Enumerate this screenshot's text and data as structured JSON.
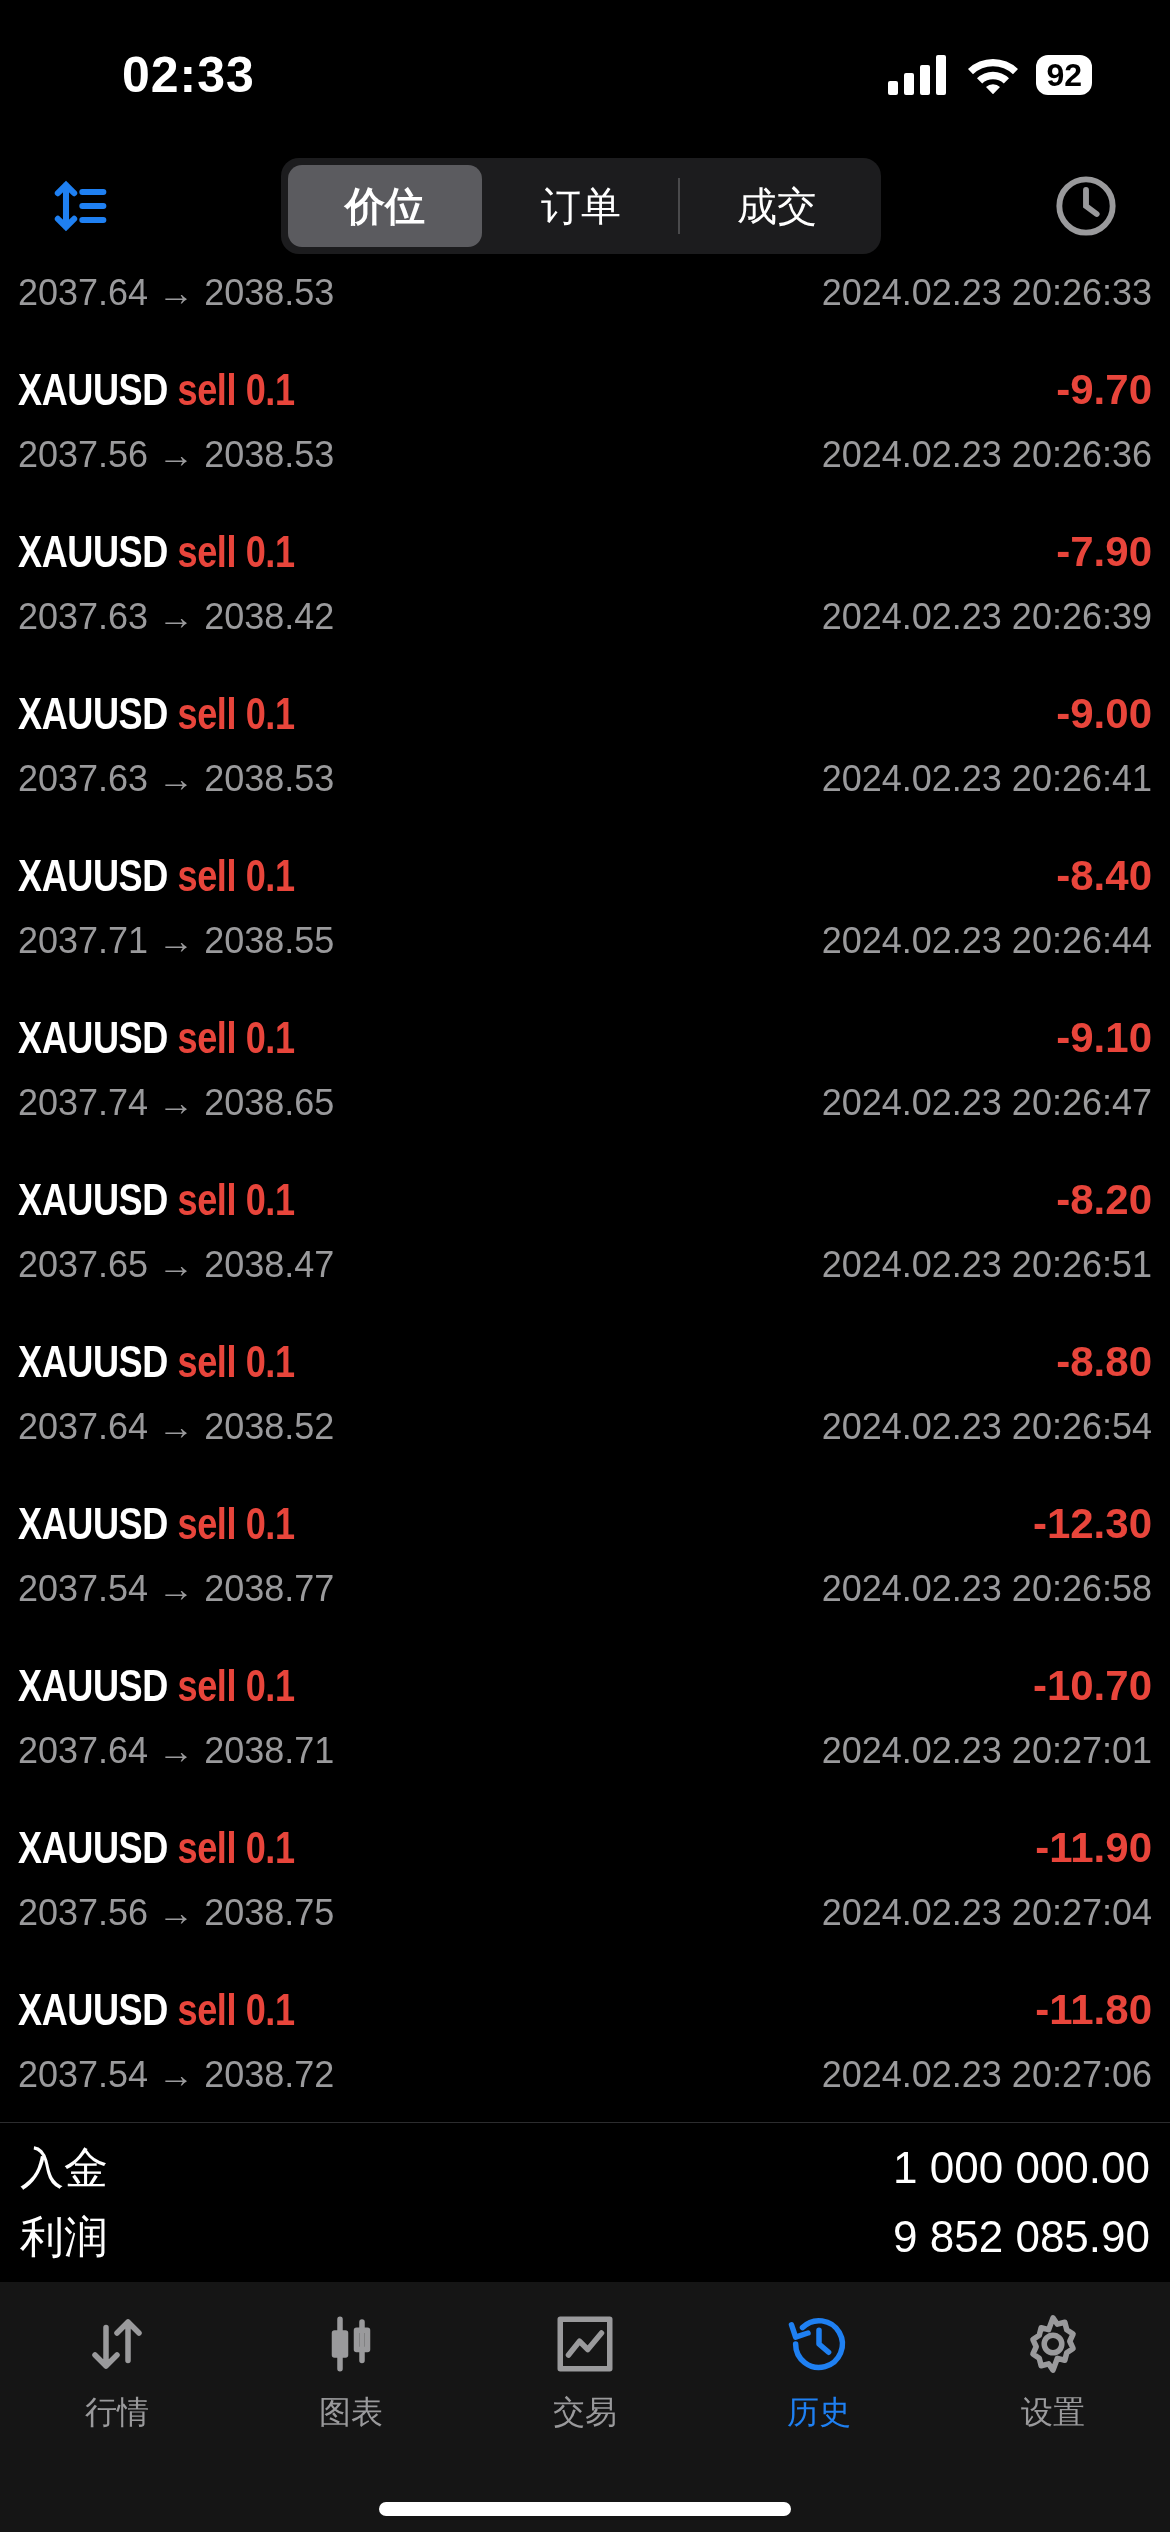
{
  "status_bar": {
    "time": "02:33",
    "battery": "92"
  },
  "segments": [
    {
      "label": "价位",
      "selected": true
    },
    {
      "label": "订单",
      "selected": false
    },
    {
      "label": "成交",
      "selected": false
    }
  ],
  "deals": [
    {
      "kind": "partial",
      "prices": "2037.64 → 2038.53",
      "time": "2024.02.23 20:26:33"
    },
    {
      "kind": "full",
      "symbol": "XAUUSD",
      "side": "sell 0.1",
      "profit": "-9.70",
      "prices": "2037.56 → 2038.53",
      "time": "2024.02.23 20:26:36"
    },
    {
      "kind": "full",
      "symbol": "XAUUSD",
      "side": "sell 0.1",
      "profit": "-7.90",
      "prices": "2037.63 → 2038.42",
      "time": "2024.02.23 20:26:39"
    },
    {
      "kind": "full",
      "symbol": "XAUUSD",
      "side": "sell 0.1",
      "profit": "-9.00",
      "prices": "2037.63 → 2038.53",
      "time": "2024.02.23 20:26:41"
    },
    {
      "kind": "full",
      "symbol": "XAUUSD",
      "side": "sell 0.1",
      "profit": "-8.40",
      "prices": "2037.71 → 2038.55",
      "time": "2024.02.23 20:26:44"
    },
    {
      "kind": "full",
      "symbol": "XAUUSD",
      "side": "sell 0.1",
      "profit": "-9.10",
      "prices": "2037.74 → 2038.65",
      "time": "2024.02.23 20:26:47"
    },
    {
      "kind": "full",
      "symbol": "XAUUSD",
      "side": "sell 0.1",
      "profit": "-8.20",
      "prices": "2037.65 → 2038.47",
      "time": "2024.02.23 20:26:51"
    },
    {
      "kind": "full",
      "symbol": "XAUUSD",
      "side": "sell 0.1",
      "profit": "-8.80",
      "prices": "2037.64 → 2038.52",
      "time": "2024.02.23 20:26:54"
    },
    {
      "kind": "full",
      "symbol": "XAUUSD",
      "side": "sell 0.1",
      "profit": "-12.30",
      "prices": "2037.54 → 2038.77",
      "time": "2024.02.23 20:26:58"
    },
    {
      "kind": "full",
      "symbol": "XAUUSD",
      "side": "sell 0.1",
      "profit": "-10.70",
      "prices": "2037.64 → 2038.71",
      "time": "2024.02.23 20:27:01"
    },
    {
      "kind": "full",
      "symbol": "XAUUSD",
      "side": "sell 0.1",
      "profit": "-11.90",
      "prices": "2037.56 → 2038.75",
      "time": "2024.02.23 20:27:04"
    },
    {
      "kind": "full",
      "symbol": "XAUUSD",
      "side": "sell 0.1",
      "profit": "-11.80",
      "prices": "2037.54 → 2038.72",
      "time": "2024.02.23 20:27:06"
    }
  ],
  "summary": [
    {
      "label": "入金",
      "value": "1 000 000.00"
    },
    {
      "label": "利润",
      "value": "9 852 085.90"
    }
  ],
  "tab_bar": [
    {
      "kind": "quotes",
      "label": "行情",
      "selected": false
    },
    {
      "kind": "chart",
      "label": "图表",
      "selected": false
    },
    {
      "kind": "trade",
      "label": "交易",
      "selected": false
    },
    {
      "kind": "history",
      "label": "历史",
      "selected": true
    },
    {
      "kind": "settings",
      "label": "设置",
      "selected": false
    }
  ]
}
